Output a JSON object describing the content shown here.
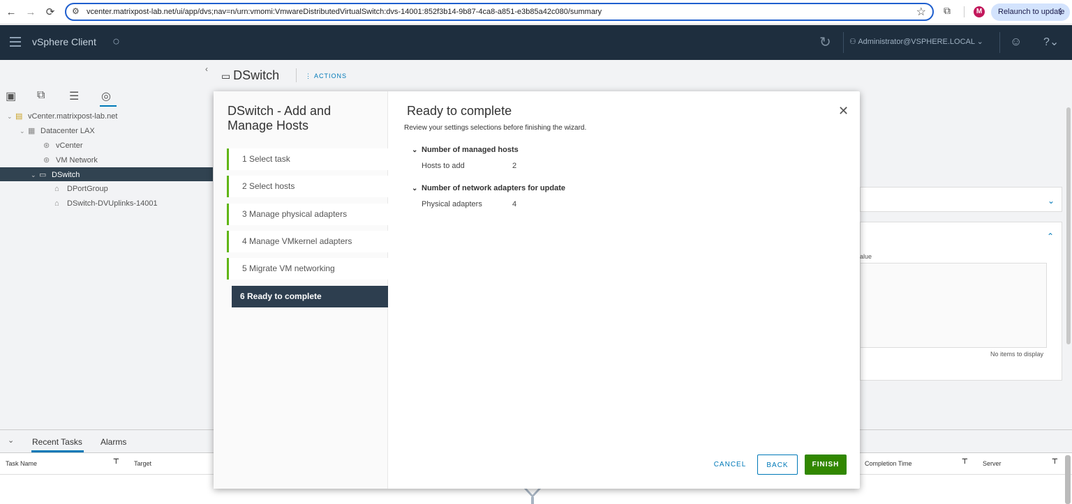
{
  "browser": {
    "url": "vcenter.matrixpost-lab.net/ui/app/dvs;nav=n/urn:vmomi:VmwareDistributedVirtualSwitch:dvs-14001:852f3b14-9b87-4ca8-a851-e3b85a42c080/summary",
    "profile_initial": "M",
    "relaunch_label": "Relaunch to update"
  },
  "header": {
    "app_name": "vSphere Client",
    "user": "Administrator@VSPHERE.LOCAL"
  },
  "tree": {
    "items": [
      {
        "label": "vCenter.matrixpost-lab.net"
      },
      {
        "label": "Datacenter LAX"
      },
      {
        "label": "vCenter"
      },
      {
        "label": "VM Network"
      },
      {
        "label": "DSwitch"
      },
      {
        "label": "DPortGroup"
      },
      {
        "label": "DSwitch-DVUplinks-14001"
      }
    ]
  },
  "object": {
    "title": "DSwitch",
    "actions_label": "ACTIONS"
  },
  "background_panel": {
    "col_fragment": "alue",
    "empty_text": "No items to display"
  },
  "tasks": {
    "tabs": [
      "Recent Tasks",
      "Alarms"
    ],
    "columns": [
      "Task Name",
      "Target",
      "Completion Time",
      "Server"
    ]
  },
  "wizard": {
    "title": "DSwitch - Add and Manage Hosts",
    "steps": [
      {
        "label": "1  Select task"
      },
      {
        "label": "2  Select hosts"
      },
      {
        "label": "3  Manage physical adapters"
      },
      {
        "label": "4  Manage VMkernel adapters"
      },
      {
        "label": "5  Migrate VM networking"
      },
      {
        "label": "6  Ready to complete"
      }
    ],
    "heading": "Ready to complete",
    "subtitle": "Review your settings selections before finishing the wizard.",
    "sections": [
      {
        "title": "Number of managed hosts",
        "key": "Hosts to add",
        "value": "2"
      },
      {
        "title": "Number of network adapters for update",
        "key": "Physical adapters",
        "value": "4"
      }
    ],
    "buttons": {
      "cancel": "CANCEL",
      "back": "BACK",
      "finish": "FINISH"
    }
  },
  "colors": {
    "header_bg": "#1e2e3e",
    "accent": "#0079b8",
    "finish_green": "#318700",
    "step_done": "#60b515",
    "active_step_bg": "#2d3e4f"
  }
}
